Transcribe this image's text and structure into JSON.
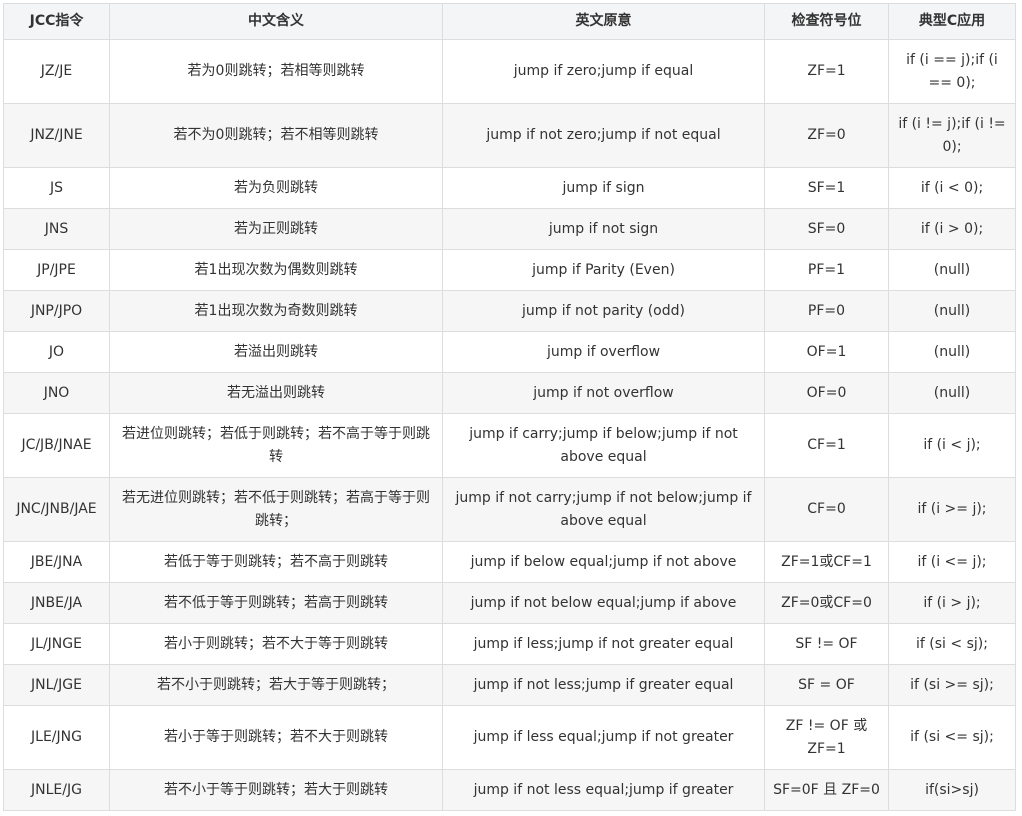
{
  "table": {
    "headers": [
      "JCC指令",
      "中文含义",
      "英文原意",
      "检查符号位",
      "典型C应用"
    ],
    "rows": [
      {
        "instr": "JZ/JE",
        "cn": "若为0则跳转；若相等则跳转",
        "en": "jump if zero;jump if equal",
        "flag": "ZF=1",
        "c": "if (i == j);if (i == 0);",
        "tall": true
      },
      {
        "instr": "JNZ/JNE",
        "cn": "若不为0则跳转；若不相等则跳转",
        "en": "jump if not zero;jump if not equal",
        "flag": "ZF=0",
        "c": "if (i != j);if (i != 0);",
        "tall": true
      },
      {
        "instr": "JS",
        "cn": "若为负则跳转",
        "en": "jump if sign",
        "flag": "SF=1",
        "c": "if (i < 0);",
        "tall": false
      },
      {
        "instr": "JNS",
        "cn": "若为正则跳转",
        "en": "jump if not sign",
        "flag": "SF=0",
        "c": "if (i > 0);",
        "tall": false
      },
      {
        "instr": "JP/JPE",
        "cn": "若1出现次数为偶数则跳转",
        "en": "jump if Parity (Even)",
        "flag": "PF=1",
        "c": "(null)",
        "tall": false
      },
      {
        "instr": "JNP/JPO",
        "cn": "若1出现次数为奇数则跳转",
        "en": "jump if not parity (odd)",
        "flag": "PF=0",
        "c": "(null)",
        "tall": false
      },
      {
        "instr": "JO",
        "cn": "若溢出则跳转",
        "en": "jump if overflow",
        "flag": "OF=1",
        "c": "(null)",
        "tall": false
      },
      {
        "instr": "JNO",
        "cn": "若无溢出则跳转",
        "en": "jump if not overflow",
        "flag": "OF=0",
        "c": "(null)",
        "tall": false
      },
      {
        "instr": "JC/JB/JNAE",
        "cn": "若进位则跳转；若低于则跳转；若不高于等于则跳转",
        "en": "jump if carry;jump if below;jump if not above equal",
        "flag": "CF=1",
        "c": "if (i < j);",
        "tall": true
      },
      {
        "instr": "JNC/JNB/JAE",
        "cn": "若无进位则跳转；若不低于则跳转；若高于等于则跳转；",
        "en": "jump if not carry;jump if not below;jump if above equal",
        "flag": "CF=0",
        "c": "if (i >= j);",
        "tall": true
      },
      {
        "instr": "JBE/JNA",
        "cn": "若低于等于则跳转；若不高于则跳转",
        "en": "jump if below equal;jump if not above",
        "flag": "ZF=1或CF=1",
        "c": "if (i <= j);",
        "tall": false
      },
      {
        "instr": "JNBE/JA",
        "cn": "若不低于等于则跳转；若高于则跳转",
        "en": "jump if not below equal;jump if above",
        "flag": "ZF=0或CF=0",
        "c": "if (i > j);",
        "tall": false
      },
      {
        "instr": "JL/JNGE",
        "cn": "若小于则跳转；若不大于等于则跳转",
        "en": "jump if less;jump if not greater equal",
        "flag": "SF != OF",
        "c": "if (si < sj);",
        "tall": false
      },
      {
        "instr": "JNL/JGE",
        "cn": "若不小于则跳转；若大于等于则跳转；",
        "en": "jump if not less;jump if greater equal",
        "flag": "SF = OF",
        "c": "if (si >= sj);",
        "tall": false
      },
      {
        "instr": "JLE/JNG",
        "cn": "若小于等于则跳转；若不大于则跳转",
        "en": "jump if less equal;jump if not greater",
        "flag": "ZF != OF 或 ZF=1",
        "c": "if (si <= sj);",
        "tall": true
      },
      {
        "instr": "JNLE/JG",
        "cn": "若不小于等于则跳转；若大于则跳转",
        "en": "jump if not less equal;jump if greater",
        "flag": "SF=0F 且 ZF=0",
        "c": "if(si>sj)",
        "tall": false
      }
    ]
  }
}
